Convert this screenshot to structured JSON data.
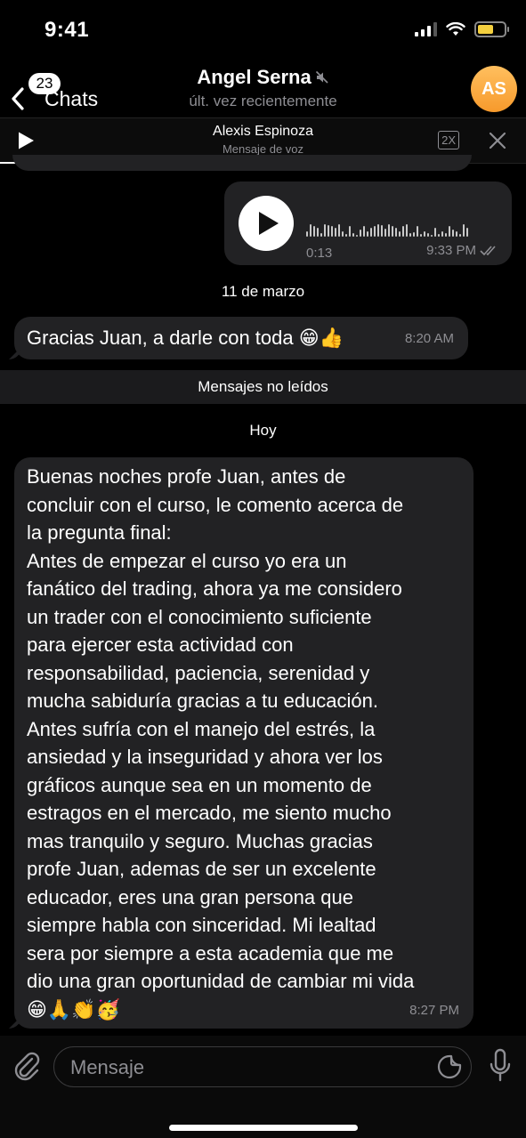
{
  "status_bar": {
    "time": "9:41"
  },
  "nav": {
    "back_badge": "23",
    "back_label": "Chats",
    "title": "Angel Serna",
    "subtitle": "últ. vez recientemente",
    "avatar_initials": "AS"
  },
  "player": {
    "name": "Alexis Espinoza",
    "subtitle": "Mensaje de voz",
    "speed": "2X"
  },
  "chat": {
    "voice_message": {
      "duration": "0:13",
      "time": "9:33 PM"
    },
    "date_1": "11 de marzo",
    "message_1": {
      "text": "Gracias Juan, a darle con toda",
      "emoji": "😁👍",
      "time": "8:20 AM"
    },
    "unread_label": "Mensajes no leídos",
    "date_2": "Hoy",
    "message_2": {
      "text": "Buenas noches profe Juan, antes de\nconcluir con el curso, le comento acerca de\nla pregunta final:\nAntes de empezar el curso yo era un\nfanático del trading, ahora ya me considero\nun trader con el conocimiento suficiente\npara ejercer esta actividad con\nresponsabilidad, paciencia, serenidad y\nmucha sabiduría gracias a tu educación.\nAntes sufría con el manejo del estrés, la\nansiedad y la inseguridad y ahora ver los\ngráficos aunque sea en un momento de\nestragos en el mercado, me siento mucho\nmas tranquilo y seguro. Muchas gracias\nprofe Juan, ademas de ser un excelente\neducador, eres una gran persona que\nsiempre habla con sinceridad. Mi lealtad\nsera por siempre a esta academia que me\ndio una gran oportunidad de cambiar mi vida",
      "emoji": "😁🙏👏🥳",
      "time": "8:27 PM"
    }
  },
  "input": {
    "placeholder": "Mensaje"
  },
  "icons": {
    "back": "chevron-left-icon",
    "mute": "mute-icon",
    "play": "play-icon",
    "close": "close-icon",
    "attach": "paperclip-icon",
    "sticker": "sticker-icon",
    "mic": "microphone-icon"
  },
  "colors": {
    "background": "#000000",
    "bubble": "#222224",
    "avatar": "#f7a13a",
    "secondary_text": "#8e8e93",
    "battery": "#f4d03f"
  }
}
